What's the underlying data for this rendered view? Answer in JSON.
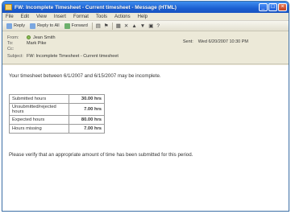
{
  "window": {
    "title": "FW: Incomplete Timesheet - Current timesheet - Message (HTML)",
    "controls": [
      "_",
      "□",
      "×"
    ]
  },
  "menu": [
    "File",
    "Edit",
    "View",
    "Insert",
    "Format",
    "Tools",
    "Actions",
    "Help"
  ],
  "toolbar": {
    "reply": "Reply",
    "reply_all": "Reply to All",
    "forward": "Forward"
  },
  "header": {
    "from_label": "From:",
    "from_value": "Jean Smith",
    "to_label": "To:",
    "to_value": "Mark Pike",
    "cc_label": "Cc:",
    "cc_value": "",
    "subject_label": "Subject:",
    "subject_value": "FW: Incomplete Timesheet - Current timesheet",
    "sent_label": "Sent:",
    "sent_value": "Wed 6/20/2007 10:30 PM"
  },
  "message": {
    "intro": "Your timesheet between 6/1/2007 and 6/15/2007 may be incomplete.",
    "rows": [
      {
        "label": "Submitted hours",
        "value": "30.00 hrs"
      },
      {
        "label": "Unsubmitted/rejected hours",
        "value": "7.00 hrs"
      },
      {
        "label": "Expected hours",
        "value": "80.00 hrs"
      },
      {
        "label": "Hours missing",
        "value": "7.00 hrs"
      }
    ],
    "closing": "Please verify that an appropriate amount of time has been submitted for this period."
  },
  "colors": {
    "titlebar": "#1b5fd1",
    "chrome": "#ece9d8"
  }
}
